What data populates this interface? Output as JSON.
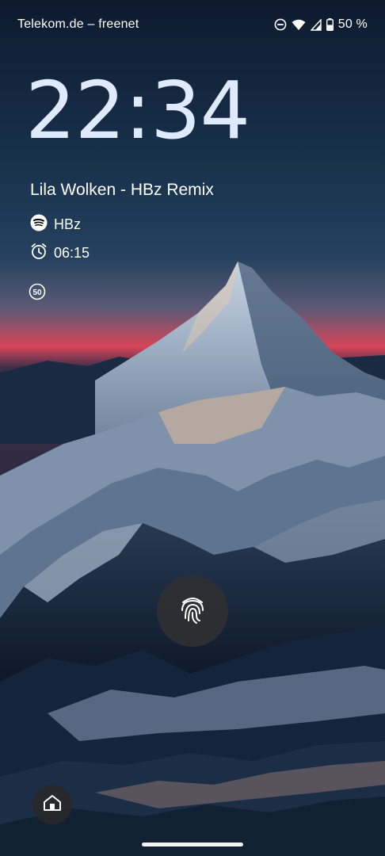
{
  "status_bar": {
    "carrier": "Telekom.de – freenet",
    "battery": "50 %",
    "icons": [
      "do-not-disturb-icon",
      "wifi-icon",
      "cellular-signal-icon",
      "battery-icon"
    ]
  },
  "lockscreen": {
    "time": "22:34",
    "media": {
      "title": "Lila Wolken - HBz Remix",
      "artist": "HBz",
      "app_icon": "spotify-icon"
    },
    "alarm": {
      "icon": "alarm-clock-icon",
      "time": "06:15"
    },
    "badge": {
      "value": "50"
    }
  },
  "actions": {
    "fingerprint_icon": "fingerprint-icon",
    "home_icon": "home-icon"
  },
  "colors": {
    "clock": "#dfe9ff",
    "sunset_band": "#d6455a",
    "sky_top": "#0f1a2e"
  }
}
